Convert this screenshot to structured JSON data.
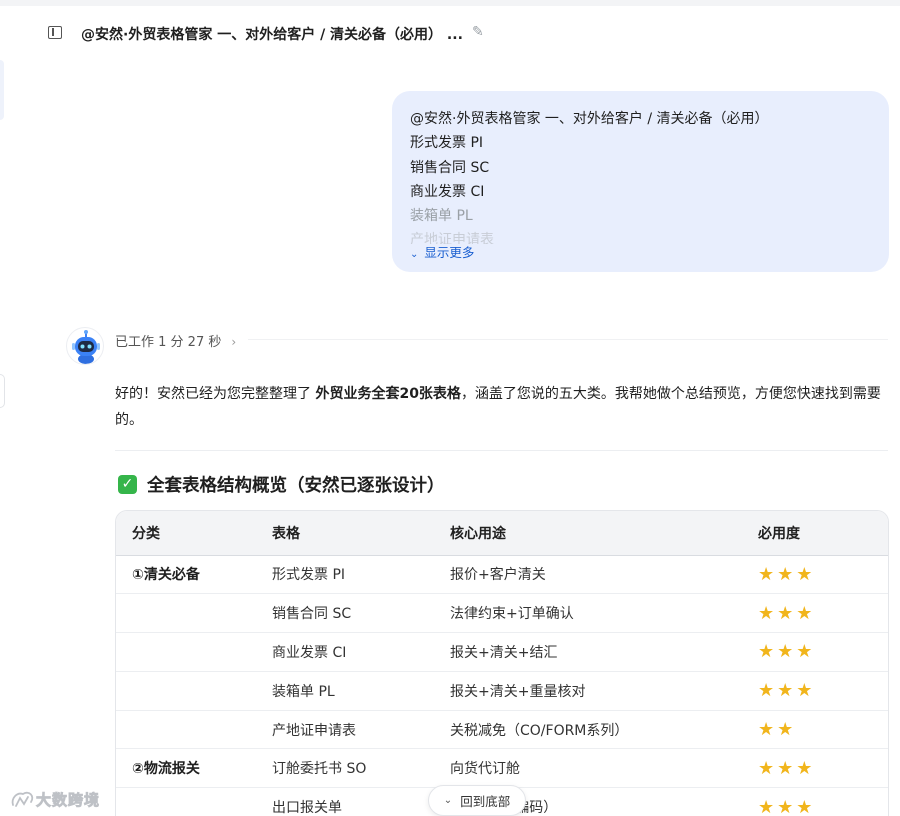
{
  "header": {
    "title": "@安然·外贸表格管家 一、对外给客户 / 清关必备（必用） ...",
    "edit_icon": "pencil-icon",
    "sidebar_icon": "sidebar-toggle-icon"
  },
  "user_message": {
    "lines": [
      "@安然·外贸表格管家 一、对外给客户 / 清关必备（必用）",
      "形式发票 PI",
      "销售合同 SC",
      "商业发票 CI",
      "装箱单 PL",
      "产地证申请表"
    ],
    "show_more": "显示更多"
  },
  "assistant": {
    "avatar_icon": "robot-avatar-icon",
    "worked": "已工作 1 分 27 秒",
    "intro_part1": "好的！安然已经为您完整整理了 ",
    "intro_bold": "外贸业务全套20张表格",
    "intro_part2": "，涵盖了您说的五大类。我帮她做个总结预览，方便您快速找到需要的。",
    "section_check": "✓",
    "section_title": "全套表格结构概览（安然已逐张设计）"
  },
  "table": {
    "headers": [
      "分类",
      "表格",
      "核心用途",
      "必用度"
    ],
    "rows": [
      [
        "①清关必备",
        "形式发票 PI",
        "报价+客户清关",
        "★★★"
      ],
      [
        "",
        "销售合同 SC",
        "法律约束+订单确认",
        "★★★"
      ],
      [
        "",
        "商业发票 CI",
        "报关+清关+结汇",
        "★★★"
      ],
      [
        "",
        "装箱单 PL",
        "报关+清关+重量核对",
        "★★★"
      ],
      [
        "",
        "产地证申请表",
        "关税减免（CO/FORM系列）",
        "★★"
      ],
      [
        "②物流报关",
        "订舱委托书 SO",
        "向货代订舱",
        "★★★"
      ],
      [
        "",
        "出口报关单",
        "（10位HS编码）",
        "★★★"
      ]
    ]
  },
  "back_to_bottom": "回到底部",
  "watermark": "大数跨境",
  "colors": {
    "bubble_bg": "#e8eefd",
    "link": "#1a5fd0",
    "star": "#f1b51c",
    "check": "#35b54a"
  }
}
